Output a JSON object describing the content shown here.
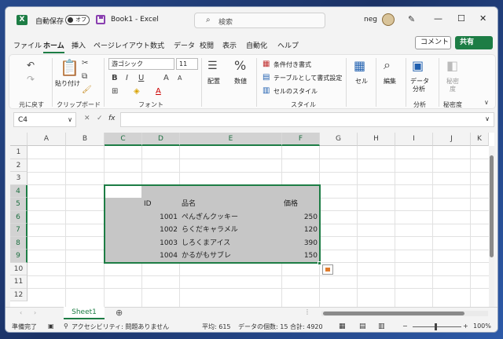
{
  "titlebar": {
    "autosave_label": "自動保存",
    "autosave_state": "オフ",
    "doc_title": "Book1  -  Excel",
    "search_placeholder": "検索",
    "user": "neg",
    "logo": "X"
  },
  "tabs": [
    "ファイル",
    "ホーム",
    "挿入",
    "ページレイアウト",
    "数式",
    "データ",
    "校閲",
    "表示",
    "自動化",
    "ヘルプ"
  ],
  "active_tab": "ホーム",
  "comment_label": "コメント",
  "share_label": "共有",
  "ribbon": {
    "undo_group": "元に戻す",
    "clipboard_group": "クリップボード",
    "paste_label": "貼り付け",
    "font_group": "フォント",
    "font_name": "游ゴシック",
    "font_size": "11",
    "bold": "B",
    "italic": "I",
    "underline": "U",
    "grow_font": "A",
    "shrink_font": "A",
    "font_color_glyph": "A",
    "align_label": "配置",
    "number_label": "数値",
    "cond_format": "条件付き書式",
    "table_format": "テーブルとして書式設定",
    "cell_styles": "セルのスタイル",
    "style_group": "スタイル",
    "cells_label": "セル",
    "editing_label": "編集",
    "analyze_label": "データ分析",
    "analyze_label_l1": "データ",
    "analyze_label_l2": "分析",
    "analysis_group": "分析",
    "sensitivity_label_l1": "秘密",
    "sensitivity_label_l2": "度",
    "sensitivity_group": "秘密度"
  },
  "formula_bar": {
    "name_box": "C4",
    "fx": "fx",
    "value": ""
  },
  "grid": {
    "columns": [
      "A",
      "B",
      "C",
      "D",
      "E",
      "F",
      "G",
      "H",
      "I",
      "J",
      "K"
    ],
    "rows": [
      "1",
      "2",
      "3",
      "4",
      "5",
      "6",
      "7",
      "8",
      "9",
      "10",
      "11",
      "12"
    ],
    "headers": {
      "id": "ID",
      "name": "品名",
      "price": "価格"
    },
    "items": [
      {
        "id": "1001",
        "name": "ぺんぎんクッキー",
        "price": "250"
      },
      {
        "id": "1002",
        "name": "らくだキャラメル",
        "price": "120"
      },
      {
        "id": "1003",
        "name": "しろくまアイス",
        "price": "390"
      },
      {
        "id": "1004",
        "name": "かるがもサブレ",
        "price": "150"
      }
    ]
  },
  "sheet_tab": "Sheet1",
  "status": {
    "ready": "準備完了",
    "accessibility": "アクセシビリティ: 問題ありません",
    "average": "平均: 615",
    "count": "データの個数: 15",
    "sum": "合計: 4920",
    "zoom": "100%"
  },
  "colors": {
    "accent": "#1d7d45",
    "selection": "#c6c6c6"
  }
}
